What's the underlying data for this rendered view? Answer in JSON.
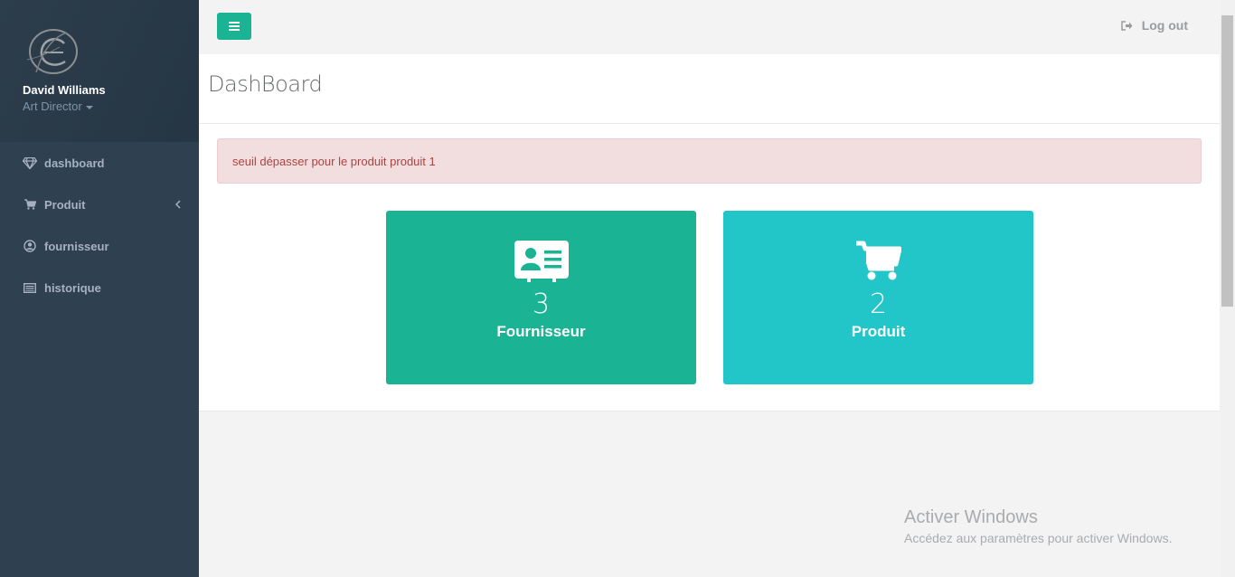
{
  "user": {
    "name": "David Williams",
    "role": "Art Director"
  },
  "sidebar": {
    "items": [
      {
        "label": "dashboard",
        "icon": "diamond-icon"
      },
      {
        "label": "Produit",
        "icon": "cart-icon",
        "has_submenu": true
      },
      {
        "label": "fournisseur",
        "icon": "user-circle-icon"
      },
      {
        "label": "historique",
        "icon": "list-icon"
      }
    ]
  },
  "topbar": {
    "logout_label": "Log out",
    "menu_icon": "hamburger-icon"
  },
  "page": {
    "title": "DashBoard"
  },
  "alert": {
    "message": "seuil dépasser pour le produit produit 1"
  },
  "cards": [
    {
      "count": "3",
      "label": "Fournisseur",
      "icon": "id-card-icon",
      "color": "#1ab394"
    },
    {
      "count": "2",
      "label": "Produit",
      "icon": "cart-icon",
      "color": "#23c6c8"
    }
  ],
  "watermark": {
    "title": "Activer Windows",
    "subtitle": "Accédez aux paramètres pour activer Windows."
  },
  "colors": {
    "sidebar_bg": "#2f4050",
    "accent": "#1ab394",
    "info": "#23c6c8",
    "alert_bg": "#f2dede",
    "alert_text": "#a94442"
  }
}
